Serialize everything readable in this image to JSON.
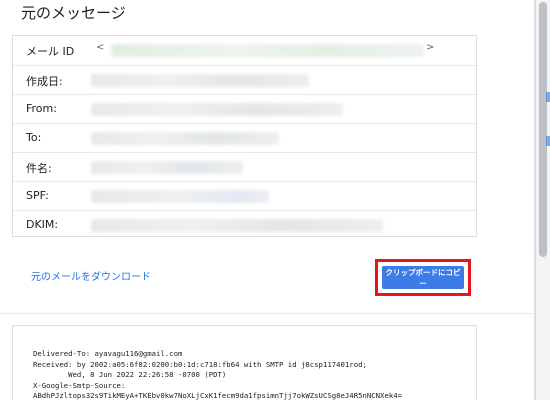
{
  "page": {
    "title": "元のメッセージ"
  },
  "meta": {
    "rows": [
      {
        "label": "メール ID",
        "open": "<",
        "close": ">"
      },
      {
        "label": "作成日:"
      },
      {
        "label": "From:"
      },
      {
        "label": "To:"
      },
      {
        "label": "件名:"
      },
      {
        "label": "SPF:"
      },
      {
        "label": "DKIM:"
      }
    ]
  },
  "actions": {
    "download_label": "元のメールをダウンロード",
    "copy_label": "クリップボードにコピー"
  },
  "source": {
    "lines": [
      "Delivered-To: ayavagu116@gmail.com",
      "Received: by 2002:a05:6f02:0200:b0:1d:c718:fb64 with SMTP id j8csp117401rod;",
      "        Wed, 8 Jun 2022 22:26:58 -0700 (PDT)",
      "X-Google-Smtp-Source:",
      "ABdhPJzltops32s9TikMEyA+TKEbv0kw7NoXLjCxK1fecm9da1fpsimnTjj7okWZsUCSg8eJ4R5nNCNXek4="
    ]
  },
  "colors": {
    "link": "#1a73e8",
    "button": "#3b7ce6",
    "highlight": "#e8141b"
  }
}
